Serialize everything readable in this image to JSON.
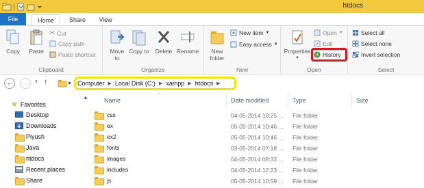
{
  "window": {
    "title": "htdocs"
  },
  "ribbon_tabs": [
    "File",
    "Home",
    "Share",
    "View"
  ],
  "clipboard": {
    "copy": "Copy",
    "paste": "Paste",
    "cut": "Cut",
    "copy_path": "Copy path",
    "paste_shortcut": "Paste shortcut",
    "label": "Clipboard"
  },
  "organize": {
    "move_to": "Move to",
    "copy_to": "Copy to",
    "delete": "Delete",
    "rename": "Rename",
    "label": "Organize"
  },
  "new_group": {
    "new_folder": "New folder",
    "new_item": "New item",
    "easy_access": "Easy access",
    "label": "New"
  },
  "open_group": {
    "properties": "Properties",
    "open": "Open",
    "edit": "Edit",
    "history": "History",
    "label": "Open"
  },
  "select_group": {
    "select_all": "Select all",
    "select_none": "Select none",
    "invert_selection": "Invert selection",
    "label": "Select"
  },
  "address": {
    "segments": [
      "Computer",
      "Local Disk (C:)",
      "xampp",
      "htdocs"
    ]
  },
  "nav_pane": [
    {
      "label": "Favorites",
      "icon": "star-icon"
    },
    {
      "label": "Desktop",
      "icon": "desktop-icon"
    },
    {
      "label": "Downloads",
      "icon": "downloads-icon"
    },
    {
      "label": "Piyush",
      "icon": "folder-icon"
    },
    {
      "label": "Java",
      "icon": "folder-icon"
    },
    {
      "label": "htdocs",
      "icon": "folder-icon"
    },
    {
      "label": "Recent places",
      "icon": "recent-places-icon"
    },
    {
      "label": "Share",
      "icon": "folder-icon"
    }
  ],
  "columns": [
    "Name",
    "Date modified",
    "Type",
    "Size"
  ],
  "files": [
    {
      "name": "css",
      "date": "04-05-2014 10:25 ...",
      "type": "File folder"
    },
    {
      "name": "ex",
      "date": "05-05-2014 10:46 ...",
      "type": "File folder"
    },
    {
      "name": "ex2",
      "date": "05-05-2014 10:46 ...",
      "type": "File folder"
    },
    {
      "name": "fonts",
      "date": "03-05-2014 07:18 ...",
      "type": "File folder"
    },
    {
      "name": "images",
      "date": "04-05-2014 08:33 ...",
      "type": "File folder"
    },
    {
      "name": "includes",
      "date": "04-05-2014 12:23 ...",
      "type": "File folder"
    },
    {
      "name": "js",
      "date": "05-05-2014 10:59 ...",
      "type": "File folder"
    }
  ],
  "colors": {
    "titlebar": "#f3c93d",
    "file_tab": "#1b74c7",
    "history_highlight": "#e0141b",
    "address_highlight": "#f3e600"
  }
}
